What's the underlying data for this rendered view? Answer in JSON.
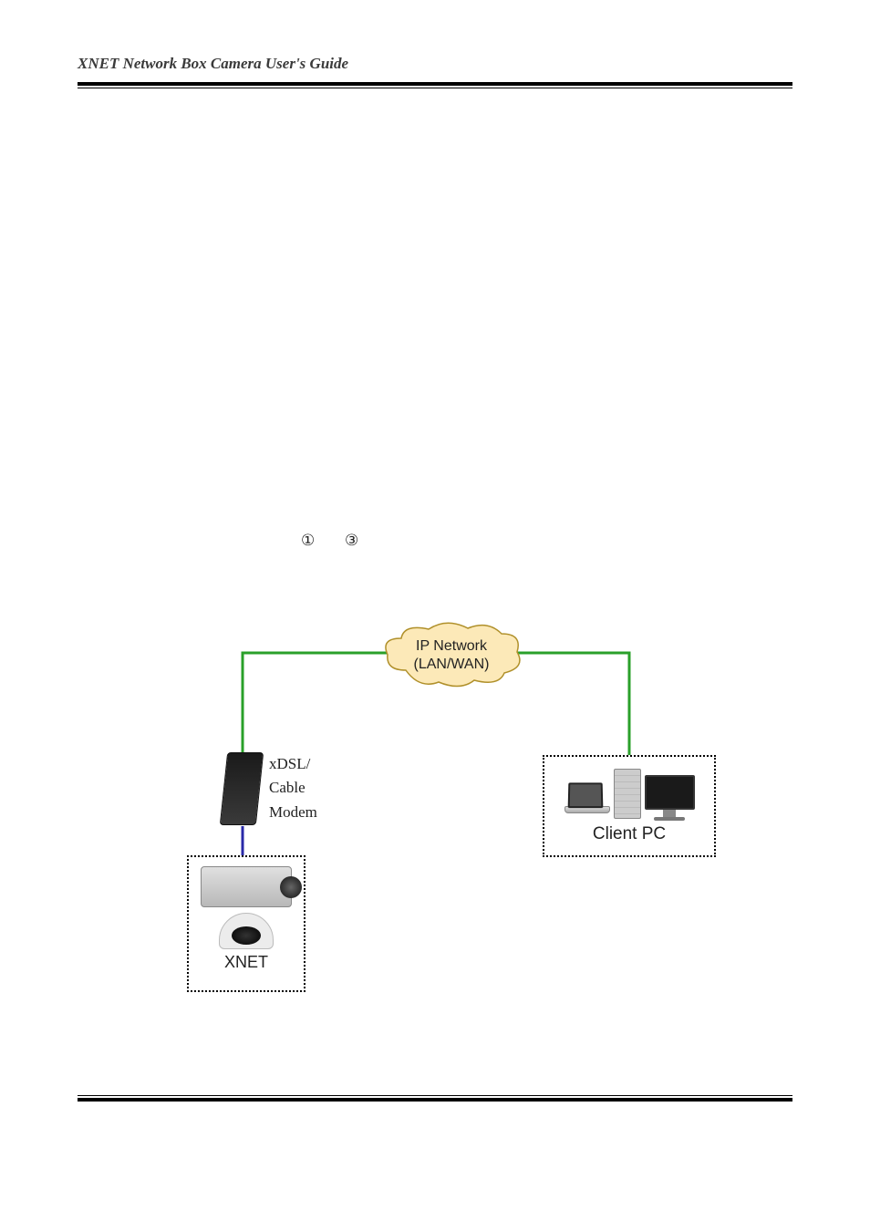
{
  "header": {
    "title": "XNET Network Box Camera User's Guide"
  },
  "markers": {
    "one": "①",
    "three": "③"
  },
  "diagram": {
    "cloud": {
      "line1": "IP Network",
      "line2": "(LAN/WAN)"
    },
    "modem": {
      "line1": "xDSL/",
      "line2": "Cable",
      "line3": "Modem"
    },
    "xnet_label": "XNET",
    "client_label": "Client PC"
  }
}
